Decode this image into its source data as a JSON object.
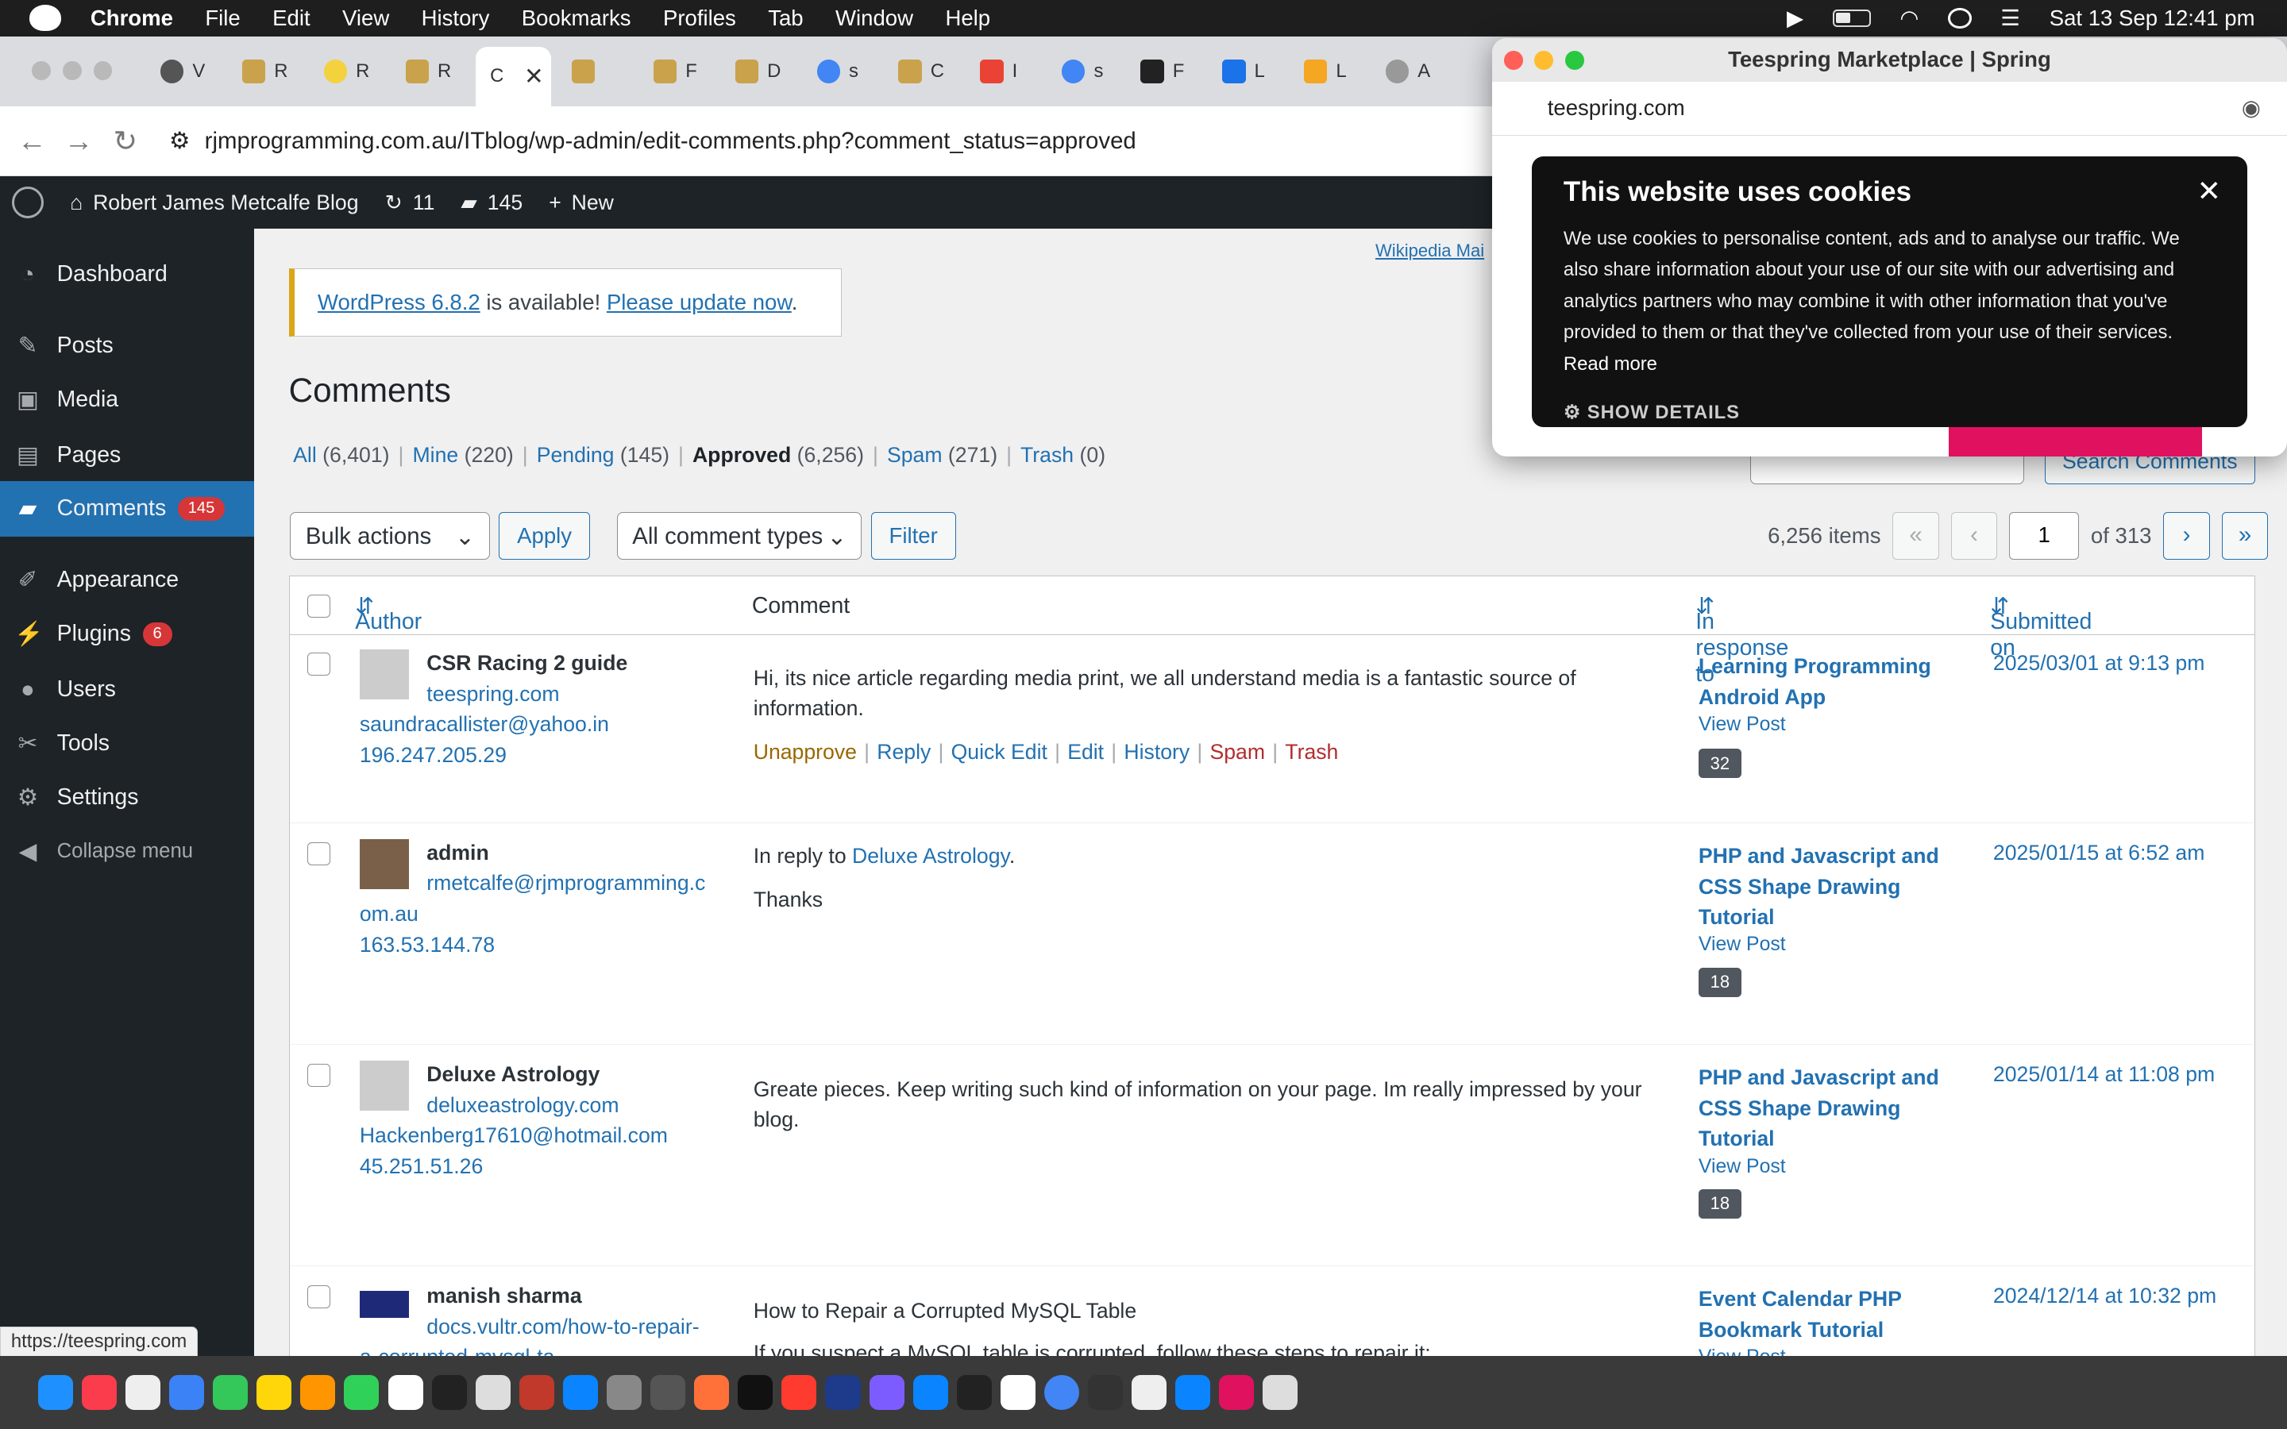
{
  "menubar": {
    "app": "Chrome",
    "items": [
      "File",
      "Edit",
      "View",
      "History",
      "Bookmarks",
      "Profiles",
      "Tab",
      "Window",
      "Help"
    ],
    "clock": "Sat 13 Sep  12:41 pm"
  },
  "browser": {
    "url": "rjmprogramming.com.au/ITblog/wp-admin/edit-comments.php?comment_status=approved",
    "tab_labels": [
      "V",
      "R",
      "R",
      "R",
      "C",
      "",
      "F",
      "D",
      "s",
      "C",
      "I",
      "s",
      "F",
      "L",
      "L",
      "A"
    ]
  },
  "adminbar": {
    "site": "Robert James Metcalfe Blog",
    "updates": "11",
    "comments": "145",
    "new": "New"
  },
  "sidebar": {
    "items": [
      {
        "label": "Dashboard",
        "icon": "dashboard-icon"
      },
      {
        "label": "Posts",
        "icon": "pin-icon"
      },
      {
        "label": "Media",
        "icon": "media-icon"
      },
      {
        "label": "Pages",
        "icon": "pages-icon"
      },
      {
        "label": "Comments",
        "icon": "comment-icon",
        "badge": "145"
      },
      {
        "label": "Appearance",
        "icon": "brush-icon"
      },
      {
        "label": "Plugins",
        "icon": "plug-icon",
        "badge": "6"
      },
      {
        "label": "Users",
        "icon": "user-icon"
      },
      {
        "label": "Tools",
        "icon": "wrench-icon"
      },
      {
        "label": "Settings",
        "icon": "settings-icon"
      },
      {
        "label": "Collapse menu",
        "icon": "collapse-icon"
      }
    ]
  },
  "notice": {
    "link1": "WordPress 6.8.2",
    "mid": " is available! ",
    "link2": "Please update now",
    "end": "."
  },
  "wiki_link": "Wikipedia Mai",
  "page_title": "Comments",
  "filters": [
    {
      "label": "All",
      "count": "(6,401)"
    },
    {
      "label": "Mine",
      "count": "(220)"
    },
    {
      "label": "Pending",
      "count": "(145)"
    },
    {
      "label": "Approved",
      "count": "(6,256)"
    },
    {
      "label": "Spam",
      "count": "(271)"
    },
    {
      "label": "Trash",
      "count": "(0)"
    }
  ],
  "controls": {
    "bulk": "Bulk actions",
    "apply": "Apply",
    "types": "All comment types",
    "filter": "Filter",
    "search": "Search Comments",
    "items": "6,256 items",
    "page": "1",
    "of": "of 313"
  },
  "table_headers": {
    "author": "Author",
    "comment": "Comment",
    "response": "In response to",
    "submitted": "Submitted on"
  },
  "rows": [
    {
      "author": "CSR Racing 2 guide",
      "site": "teespring.com",
      "email": "saundracallister@yahoo.in",
      "ip": "196.247.205.29",
      "comment": "Hi, its nice article regarding media print, we all understand media is a fantastic source of information.",
      "post": "Learning Programming Android App",
      "view": "View Post",
      "count": "32",
      "date": "2025/03/01 at 9:13 pm"
    },
    {
      "author": "admin",
      "email": "rmetcalfe@rjmprogramming.c",
      "email2": "om.au",
      "ip": "163.53.144.78",
      "reply_prefix": "In reply to ",
      "reply_to": "Deluxe Astrology",
      "comment": "Thanks",
      "post": "PHP and Javascript and CSS Shape Drawing Tutorial",
      "view": "View Post",
      "count": "18",
      "date": "2025/01/15 at 6:52 am"
    },
    {
      "author": "Deluxe Astrology",
      "site": "deluxeastrology.com",
      "email": "Hackenberg17610@hotmail.com",
      "ip": "45.251.51.26",
      "comment": "Greate pieces. Keep writing such kind of information on your page. Im really impressed by your blog.",
      "post": "PHP and Javascript and CSS Shape Drawing Tutorial",
      "view": "View Post",
      "count": "18",
      "date": "2025/01/14 at 11:08 pm"
    },
    {
      "author": "manish sharma",
      "site": "docs.vultr.com/how-to-repair-",
      "site2": "a-corrupted-mysql-ta",
      "comment": "How to Repair a Corrupted MySQL Table",
      "comment2": "If you suspect a MySQL table is corrupted, follow these steps to repair it:",
      "post": "Event Calendar PHP Bookmark Tutorial",
      "view": "View Post",
      "date": "2024/12/14 at 10:32 pm"
    }
  ],
  "row_actions": [
    "Unapprove",
    "Reply",
    "Quick Edit",
    "Edit",
    "History",
    "Spam",
    "Trash"
  ],
  "popup": {
    "title": "Teespring Marketplace | Spring",
    "url": "teespring.com",
    "cookie_title": "This website uses cookies",
    "cookie_text": "We use cookies to personalise content, ads and to analyse our traffic. We also share information about your use of our site with our advertising and analytics partners who may combine it with other information that you've provided to them or that they've collected from your use of their services.",
    "read_more": "Read more",
    "show_details": "SHOW DETAILS"
  },
  "statusbar": "https://teespring.com",
  "colors": {
    "wp_blue": "#2271b1",
    "admin_dark": "#1d2327",
    "badge_red": "#d63638",
    "notice_yellow": "#dba617"
  }
}
